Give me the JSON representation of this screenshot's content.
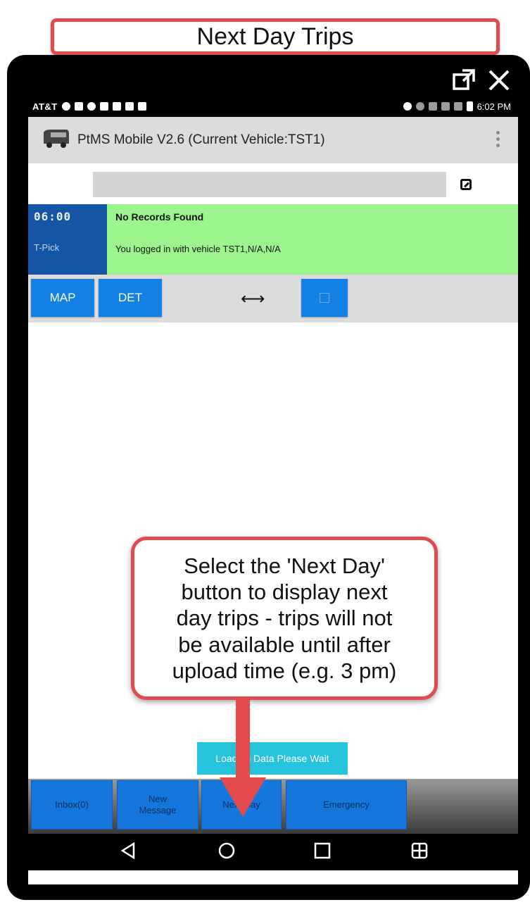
{
  "annotation": {
    "title": "Next Day Trips",
    "callout": "Select the 'Next Day'\nbutton to display next\nday trips - trips will not\nbe available until after\nupload time (e.g. 3 pm)",
    "accent_color": "#e24a4e"
  },
  "window_controls": {
    "popout_icon": "external-link-icon",
    "close_icon": "close-icon"
  },
  "status_bar": {
    "carrier": "AT&T",
    "time": "6:02 PM"
  },
  "app_bar": {
    "title": "PtMS Mobile V2.6  (Current Vehicle:TST1)",
    "icon": "bus-icon",
    "menu_icon": "overflow-menu-icon"
  },
  "search": {
    "value": ""
  },
  "trip": {
    "time": "06:00",
    "type": "T-Pick",
    "heading": "No Records Found",
    "message": "You logged in with vehicle TST1,N/A,N/A",
    "time_bg_color": "#1455a6",
    "info_bg_color": "#9cf48c"
  },
  "actions": {
    "map_label": "MAP",
    "det_label": "DET",
    "resize_symbol": "⟷"
  },
  "loading": {
    "text": "Loading Data Please Wait"
  },
  "bottom_nav": {
    "inbox_label": "Inbox(0)",
    "new_message_label": "New\nMessage",
    "next_day_label": "Next Day",
    "emergency_label": "Emergency"
  },
  "colors": {
    "button_blue": "#1580e4",
    "loading_cyan": "#26c4dc"
  }
}
